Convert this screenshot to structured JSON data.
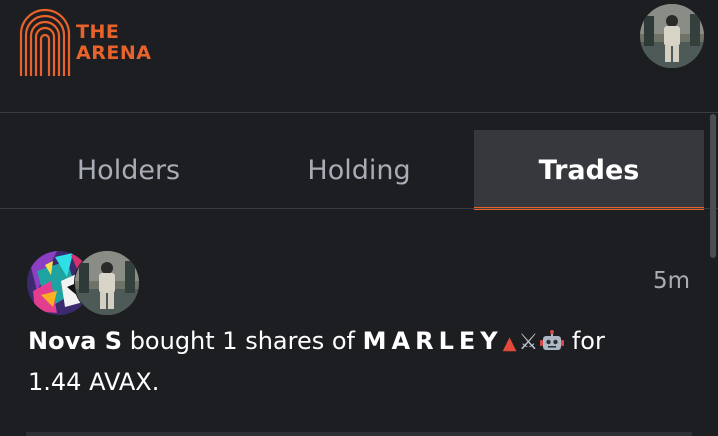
{
  "brand": {
    "line1": "THE",
    "line2": "ARENA",
    "accent_color": "#e8622c"
  },
  "header": {
    "avatar_icon": "user-avatar"
  },
  "tabs": [
    {
      "label": "Holders",
      "active": false
    },
    {
      "label": "Holding",
      "active": false
    },
    {
      "label": "Trades",
      "active": true
    }
  ],
  "trade": {
    "time": "5m",
    "trader": "Nova S",
    "action": " bought 1 shares of ",
    "ticker": "MARLEY",
    "emojis": [
      "red-triangle",
      "crossed-swords",
      "robot"
    ],
    "for_text": "for",
    "amount": "1.44 AVAX."
  }
}
